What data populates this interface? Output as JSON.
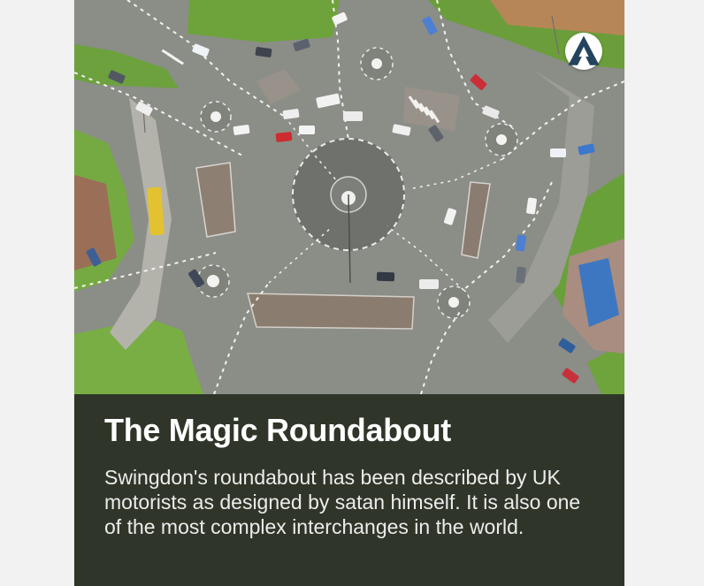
{
  "card": {
    "title": "The Magic Roundabout",
    "description": "Swingdon's roundabout has been described by UK motorists as designed by satan himself. It is also one of the most complex interchanges in the world."
  },
  "colors": {
    "caption_background": "#2f3528",
    "road": "#8d8f89",
    "grass": "#6fa43d",
    "logo_mark": "#24435c"
  },
  "icons": {
    "brand_logo": "triangle-a-logo-icon"
  }
}
